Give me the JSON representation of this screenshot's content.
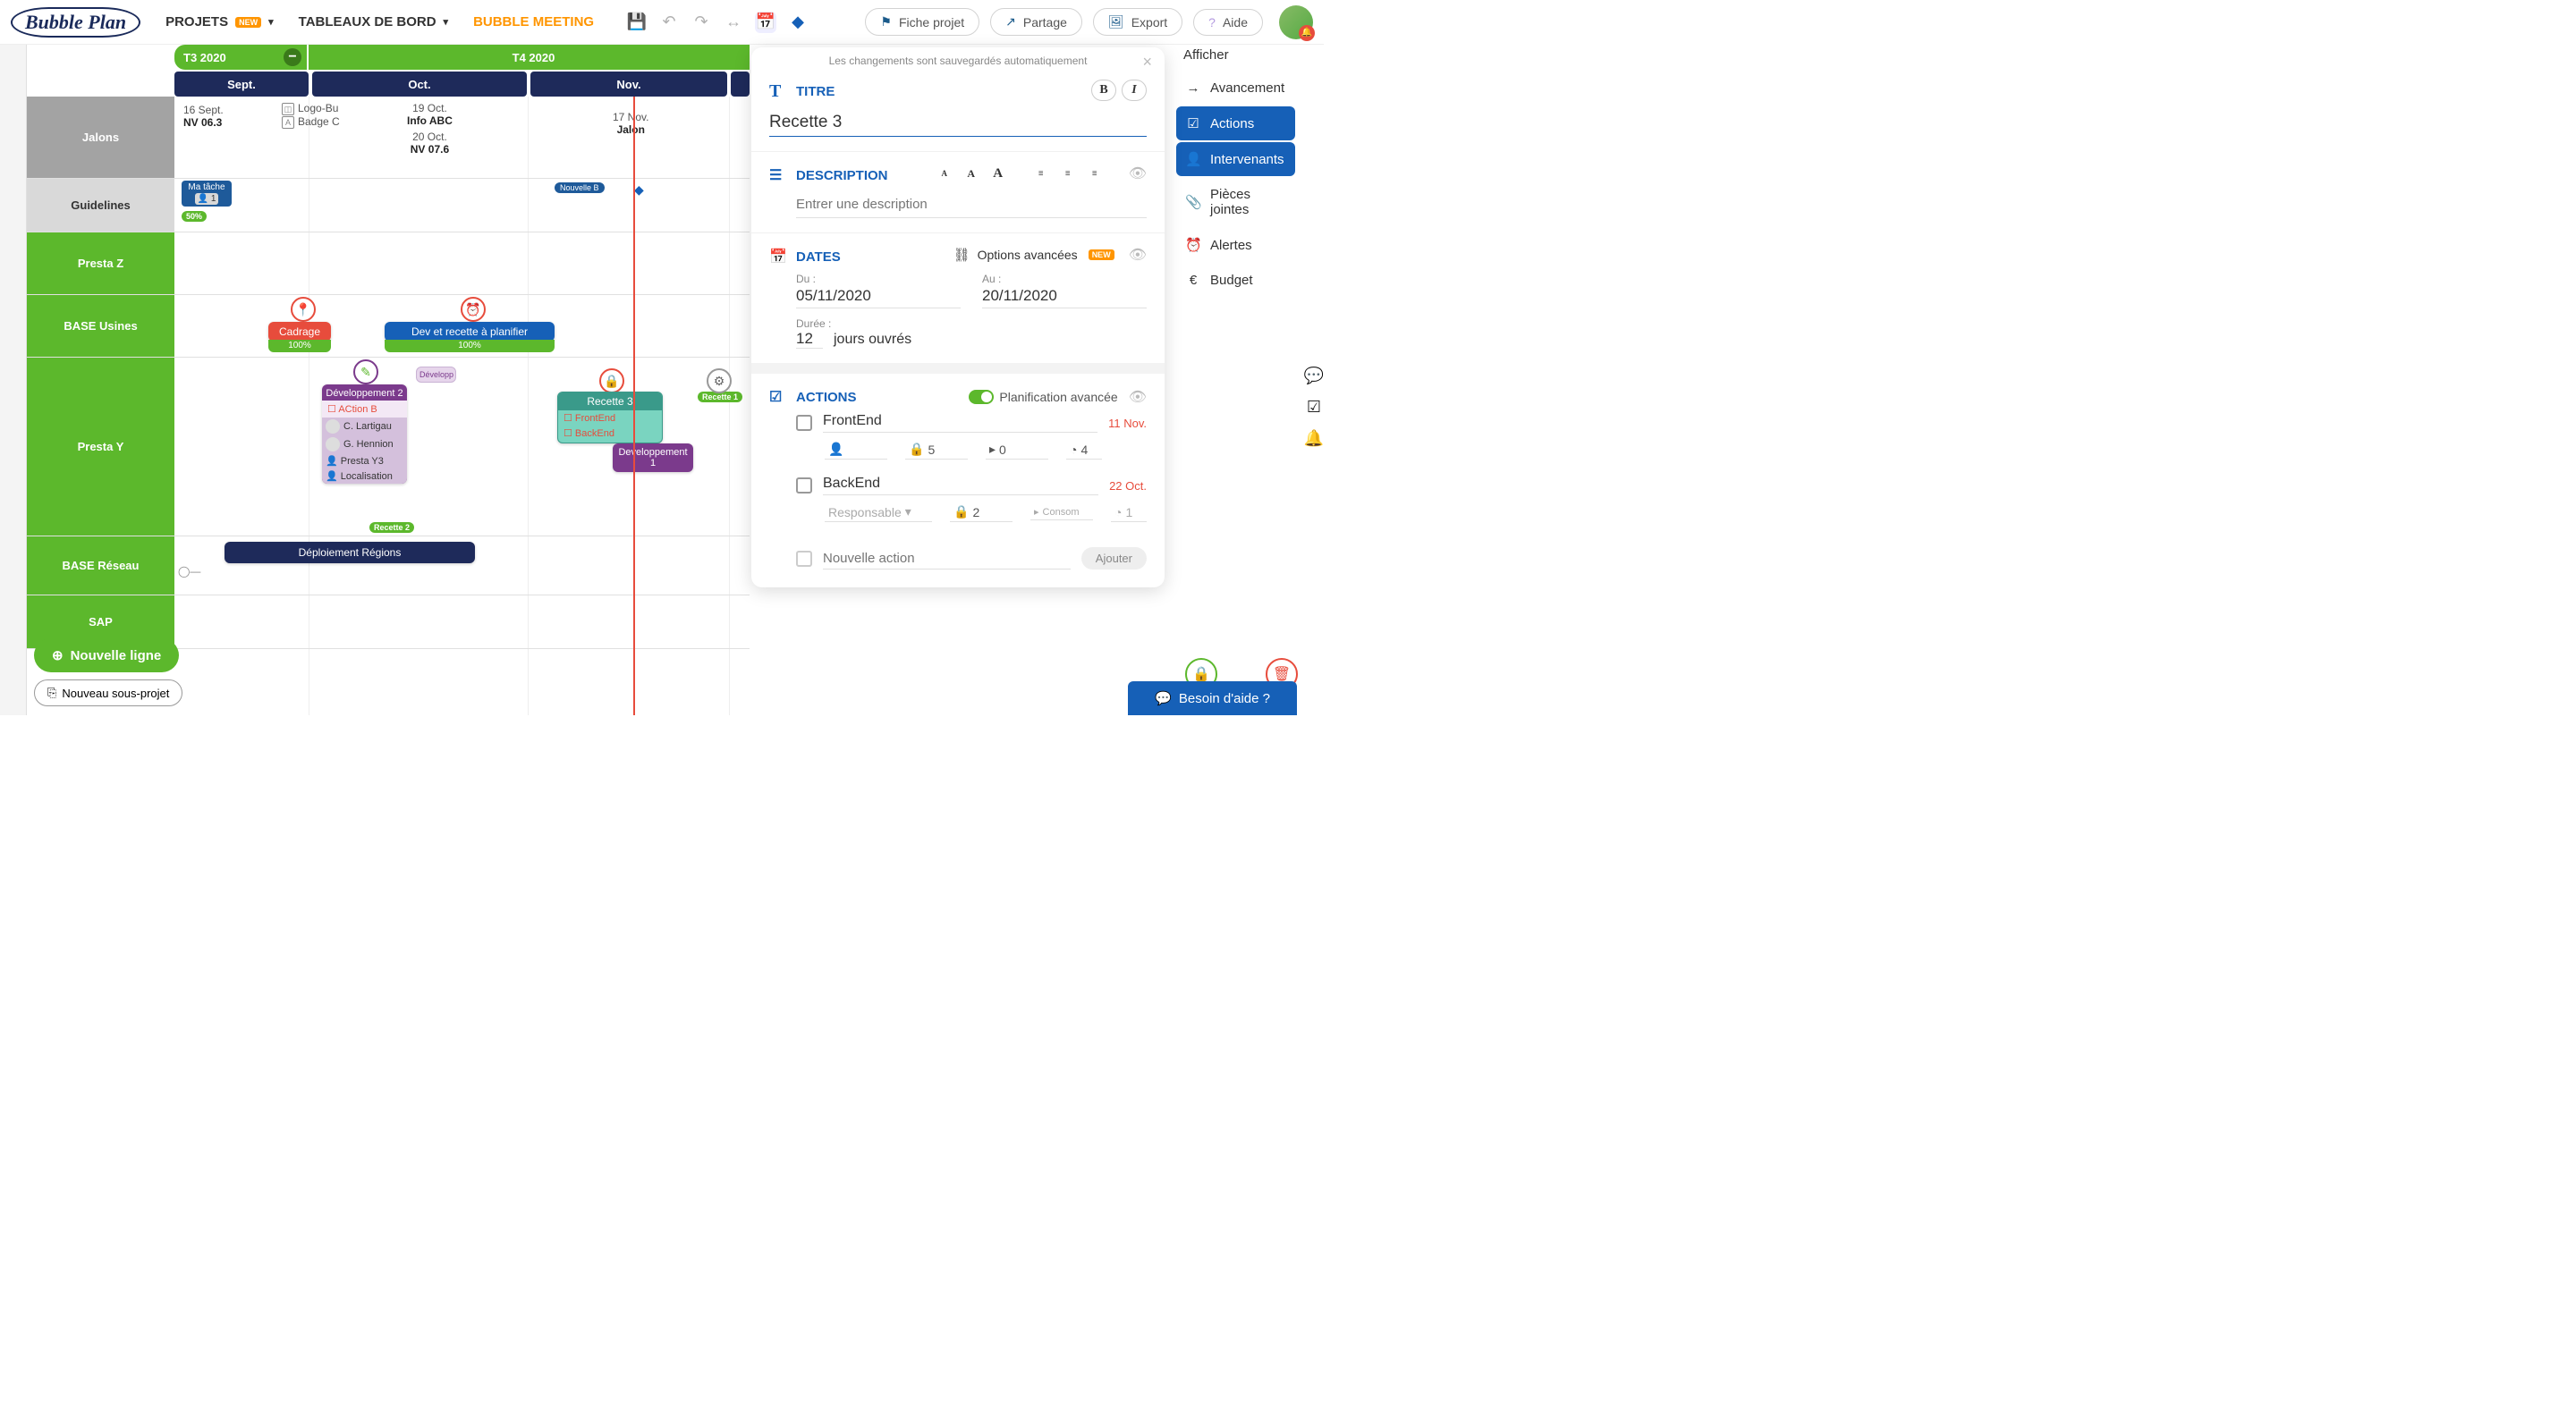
{
  "topnav": {
    "logo": "Bubble Plan",
    "projets": "PROJETS",
    "new_badge": "NEW",
    "tableaux": "TABLEAUX DE BORD",
    "meeting": "BUBBLE MEETING",
    "fiche_projet": "Fiche projet",
    "partage": "Partage",
    "export": "Export",
    "aide": "Aide"
  },
  "quarters": [
    "T3 2020",
    "T4 2020"
  ],
  "months": [
    "Sept.",
    "Oct.",
    "Nov."
  ],
  "rows": {
    "jalons": "Jalons",
    "guidelines": "Guidelines",
    "presta_z": "Presta Z",
    "base_usines": "BASE Usines",
    "presta_y": "Presta Y",
    "base_reseau": "BASE Réseau",
    "sap": "SAP"
  },
  "jalons": {
    "c1_date": "16 Sept.",
    "c1_label": "NV 06.3",
    "c2_doc1": "Logo-Bu",
    "c2_doc2": "Badge C",
    "c3_date1": "19 Oct.",
    "c3_label1": "Info ABC",
    "c3_date2": "20 Oct.",
    "c3_label2": "NV 07.6",
    "c4_date": "17 Nov.",
    "c4_label": "Jalon"
  },
  "guidelines": {
    "matache": "Ma tâche",
    "count": "1",
    "pct": "50%",
    "nouvelle": "Nouvelle B"
  },
  "tasks": {
    "cadrage": "Cadrage",
    "cadrage_pct": "100%",
    "devrecette": "Dev et recette à planifier",
    "devrecette_pct": "100%",
    "developp_mini": "Développ",
    "dev2": "Développement 2",
    "actionb": "ACtion B",
    "p1": "C. Lartigau",
    "p2": "G. Hennion",
    "p3": "Presta Y3",
    "p4": "Localisation",
    "recette2": "Recette 2",
    "recette3": "Recette 3",
    "frontend": "FrontEnd",
    "backend": "BackEnd",
    "recette1": "Recette 1",
    "dev1": "Developpement 1",
    "deploiement": "Déploiement Régions"
  },
  "bottom": {
    "nouvelle_ligne": "Nouvelle ligne",
    "nouveau_sp": "Nouveau sous-projet"
  },
  "panel": {
    "autosave": "Les changements sont sauvegardés automatiquement",
    "titre_label": "TITRE",
    "titre_value": "Recette 3",
    "desc_label": "DESCRIPTION",
    "desc_placeholder": "Entrer une description",
    "dates_label": "DATES",
    "options_avancees": "Options avancées",
    "new_badge": "NEW",
    "du": "Du :",
    "du_val": "05/11/2020",
    "au": "Au :",
    "au_val": "20/11/2020",
    "duree": "Durée :",
    "duree_val": "12",
    "duree_unit": "jours ouvrés",
    "actions_label": "ACTIONS",
    "planif": "Planification avancée",
    "a1_name": "FrontEnd",
    "a1_date": "11 Nov.",
    "a1_charge": "5",
    "a1_consomme": "0",
    "a1_pct": "4",
    "a2_name": "BackEnd",
    "a2_date": "22 Oct.",
    "a2_responsable": "Responsable",
    "a2_charge": "2",
    "a2_consomme": "Consom",
    "a2_pct": "1",
    "nouvelle_action": "Nouvelle action",
    "ajouter": "Ajouter"
  },
  "rightbar": {
    "title": "Afficher",
    "avancement": "Avancement",
    "actions": "Actions",
    "intervenants": "Intervenants",
    "pieces": "Pièces jointes",
    "alertes": "Alertes",
    "budget": "Budget"
  },
  "help": "Besoin d'aide ?"
}
